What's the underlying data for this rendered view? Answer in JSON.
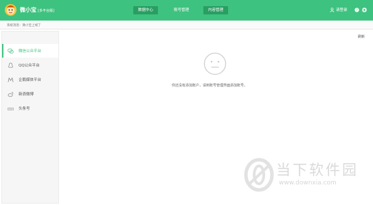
{
  "header": {
    "app_name": "微小宝",
    "app_subtitle": "[多平台版]",
    "tabs": [
      {
        "label": "数据中心"
      },
      {
        "label": "账号管理"
      },
      {
        "label": "内容管理"
      }
    ],
    "login_label": "请登录",
    "icons": [
      "user-icon",
      "help-icon",
      "gear-icon"
    ],
    "accent_color": "#3ec27f"
  },
  "system_bar": {
    "message": "系统消息：微小宝上线了"
  },
  "sidebar": {
    "items": [
      {
        "label": "微信公众平台",
        "icon": "wechat-icon",
        "active": true
      },
      {
        "label": "QQ公众平台",
        "icon": "qq-icon",
        "active": false
      },
      {
        "label": "企鹅媒体平台",
        "icon": "penguin-media-icon",
        "active": false
      },
      {
        "label": "新浪微博",
        "icon": "weibo-icon",
        "active": false
      },
      {
        "label": "头条号",
        "icon": "toutiao-icon",
        "active": false
      }
    ]
  },
  "main": {
    "refresh_label": "刷新",
    "empty_message": "你还没有添加账户，请到账号管理界面添加账号。",
    "empty_icon": "neutral-face-icon"
  },
  "watermark": {
    "name": "当下软件园",
    "url": "www.downxia.com"
  }
}
